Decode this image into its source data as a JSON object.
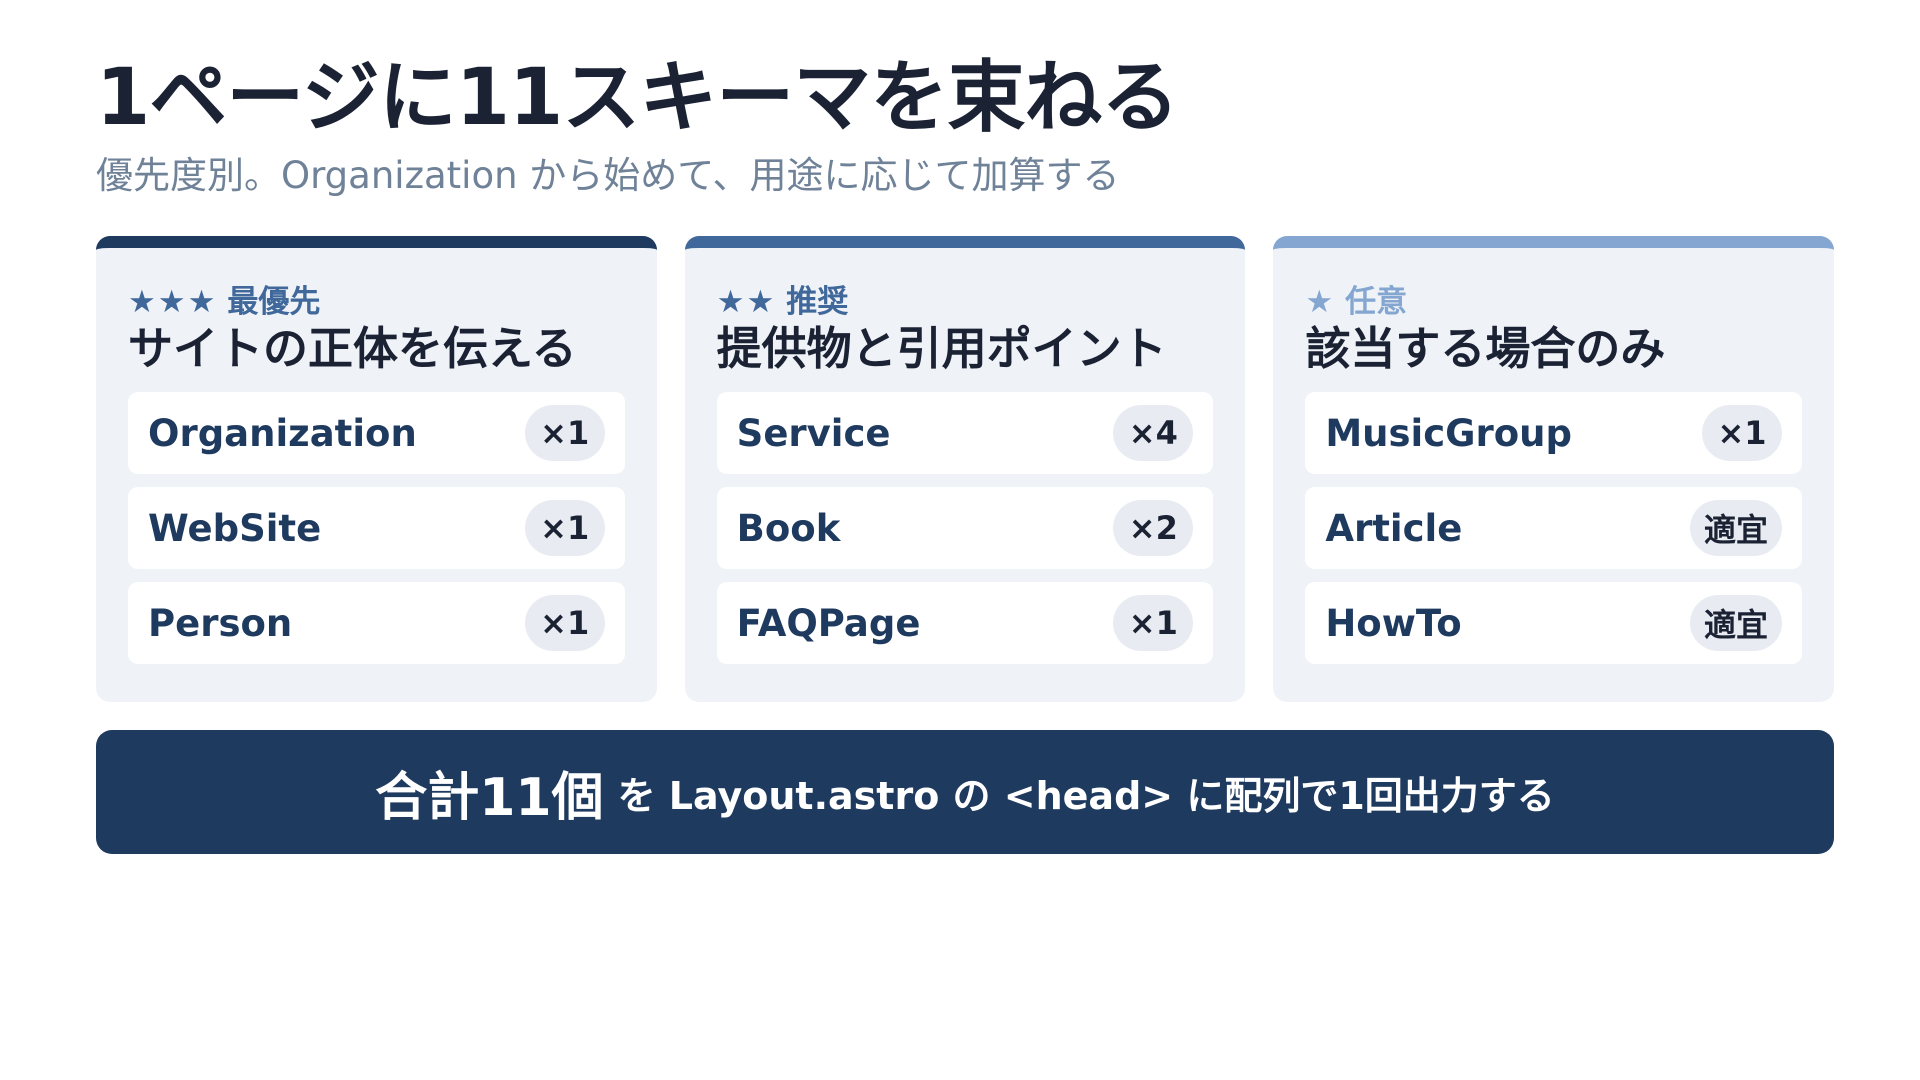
{
  "title": "1ページに11スキーマを束ねる",
  "subtitle": "優先度別。Organization から始めて、用途に応じて加算する",
  "colors": {
    "navy": "#1f3a5f",
    "mid_blue": "#41689a",
    "light_blue": "#84a6d1",
    "card_bg": "#eff3f8",
    "text_dark": "#1b2233",
    "subtitle_gray": "#6f8298"
  },
  "cards": [
    {
      "stars": "★★★",
      "priority": "最優先",
      "heading": "サイトの正体を伝える",
      "items": [
        {
          "name": "Organization",
          "count": "×1"
        },
        {
          "name": "WebSite",
          "count": "×1"
        },
        {
          "name": "Person",
          "count": "×1"
        }
      ]
    },
    {
      "stars": "★★",
      "priority": "推奨",
      "heading": "提供物と引用ポイント",
      "items": [
        {
          "name": "Service",
          "count": "×4"
        },
        {
          "name": "Book",
          "count": "×2"
        },
        {
          "name": "FAQPage",
          "count": "×1"
        }
      ]
    },
    {
      "stars": "★",
      "priority": "任意",
      "heading": "該当する場合のみ",
      "items": [
        {
          "name": "MusicGroup",
          "count": "×1"
        },
        {
          "name": "Article",
          "count": "適宜"
        },
        {
          "name": "HowTo",
          "count": "適宜"
        }
      ]
    }
  ],
  "banner": {
    "strong": "合計11個",
    "rest": "を Layout.astro の <head> に配列で1回出力する"
  }
}
